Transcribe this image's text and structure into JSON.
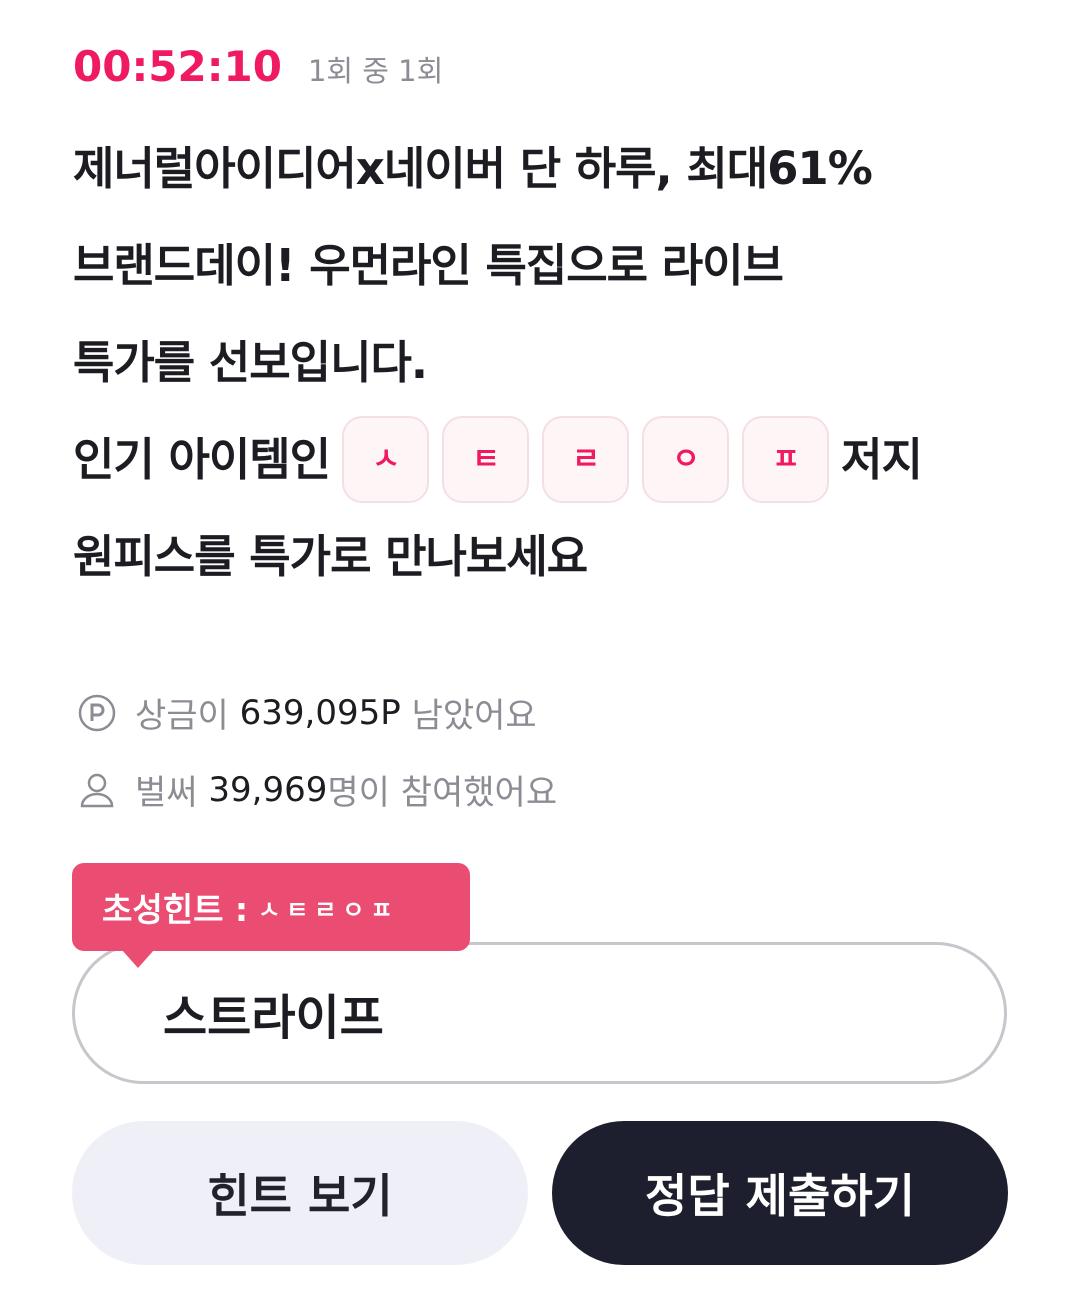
{
  "header": {
    "timer": "00:52:10",
    "round": "1회 중 1회"
  },
  "question": {
    "line1": "제너럴아이디어x네이버 단 하루, 최대61%",
    "line2": "브랜드데이! 우먼라인 특집으로 라이브",
    "line3": "특가를 선보입니다.",
    "line4_prefix": "인기 아이템인",
    "blanks": [
      "ㅅ",
      "ㅌ",
      "ㄹ",
      "ㅇ",
      "ㅍ"
    ],
    "line4_suffix": "저지",
    "line5": "원피스를 특가로 만나보세요"
  },
  "prize": {
    "prefix": "상금이",
    "amount": "639,095P",
    "suffix": "남았어요",
    "icon": "point-coin-icon"
  },
  "participants": {
    "prefix": "벌써",
    "count": "39,969",
    "suffix": "명이 참여했어요",
    "icon": "person-icon"
  },
  "hint_tooltip": {
    "label": "초성힌트 :",
    "chars": "ㅅㅌㄹㅇㅍ"
  },
  "answer": {
    "value": "스트라이프"
  },
  "buttons": {
    "hint": "힌트 보기",
    "submit": "정답 제출하기"
  },
  "colors": {
    "accent": "#f01a62",
    "tooltip": "#ea4c72",
    "submit_bg": "#1e1f2e",
    "hint_bg": "#eff0f7"
  }
}
